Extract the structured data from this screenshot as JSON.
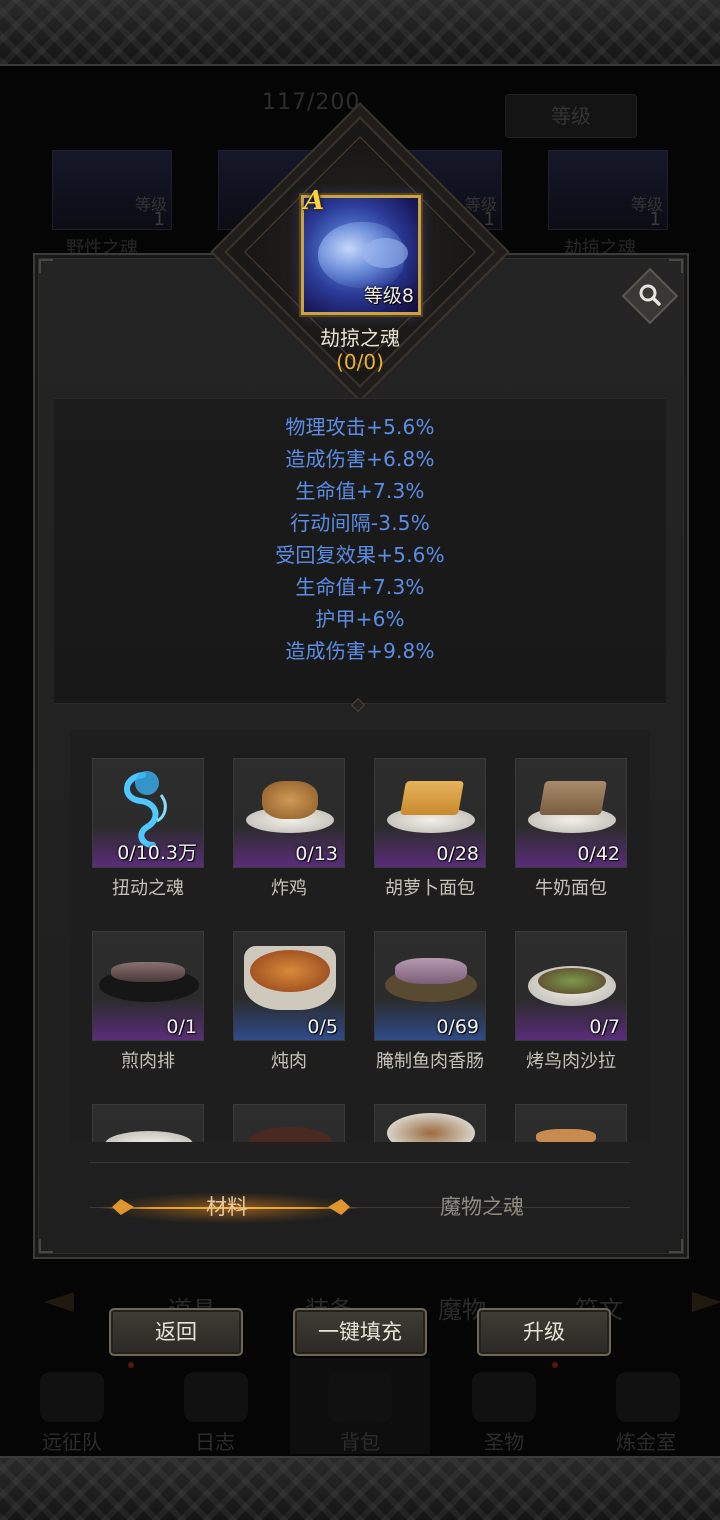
{
  "background": {
    "count": "117/200",
    "sort_button": "等级",
    "cards": [
      {
        "level_label": "等级",
        "level": "1",
        "name": "野性之魂"
      },
      {
        "level_label": "",
        "level": "",
        "name": ""
      },
      {
        "level_label": "等级",
        "level": "1",
        "name": ""
      },
      {
        "level_label": "等级",
        "level": "1",
        "name": "劫掠之魂"
      }
    ],
    "tabs": [
      "道具",
      "装备",
      "魔物",
      "符文"
    ],
    "nav": [
      "远征队",
      "日志",
      "背包",
      "圣物",
      "炼金室"
    ]
  },
  "detail": {
    "rank": "A",
    "level": "等级8",
    "name": "劫掠之魂",
    "progress": "(0/0)",
    "stats": [
      "物理攻击+5.6%",
      "造成伤害+6.8%",
      "生命值+7.3%",
      "行动间隔-3.5%",
      "受回复效果+5.6%",
      "生命值+7.3%",
      "护甲+6%",
      "造成伤害+9.8%"
    ]
  },
  "materials": [
    {
      "count": "0/10.3万",
      "label": "扭动之魂",
      "rarity": "purple",
      "icon": "blue-wisp-icon"
    },
    {
      "count": "0/13",
      "label": "炸鸡",
      "rarity": "purple",
      "icon": "fried-chicken-icon"
    },
    {
      "count": "0/28",
      "label": "胡萝卜面包",
      "rarity": "purple",
      "icon": "carrot-bread-icon"
    },
    {
      "count": "0/42",
      "label": "牛奶面包",
      "rarity": "purple",
      "icon": "milk-bread-icon"
    },
    {
      "count": "0/1",
      "label": "煎肉排",
      "rarity": "purple",
      "icon": "fried-steak-icon"
    },
    {
      "count": "0/5",
      "label": "炖肉",
      "rarity": "blue",
      "icon": "stew-icon"
    },
    {
      "count": "0/69",
      "label": "腌制鱼肉香肠",
      "rarity": "blue",
      "icon": "fish-sausage-icon"
    },
    {
      "count": "0/7",
      "label": "烤鸟肉沙拉",
      "rarity": "purple",
      "icon": "bird-salad-icon"
    },
    {
      "count": "",
      "label": "",
      "rarity": "purple",
      "icon": "dish-icon"
    },
    {
      "count": "",
      "label": "",
      "rarity": "purple",
      "icon": "dish-icon"
    },
    {
      "count": "",
      "label": "",
      "rarity": "purple",
      "icon": "dish-icon"
    },
    {
      "count": "",
      "label": "",
      "rarity": "purple",
      "icon": "dish-icon"
    }
  ],
  "tabs": {
    "materials": "材料",
    "monster_soul": "魔物之魂"
  },
  "buttons": {
    "back": "返回",
    "auto_fill": "一键填充",
    "upgrade": "升级"
  },
  "colors": {
    "stat_text": "#5b8ee6",
    "progress_text": "#e9b233",
    "rarity_purple": "#5a2d7a",
    "rarity_blue": "#2f4c8a",
    "active_tab": "#e29a30"
  }
}
